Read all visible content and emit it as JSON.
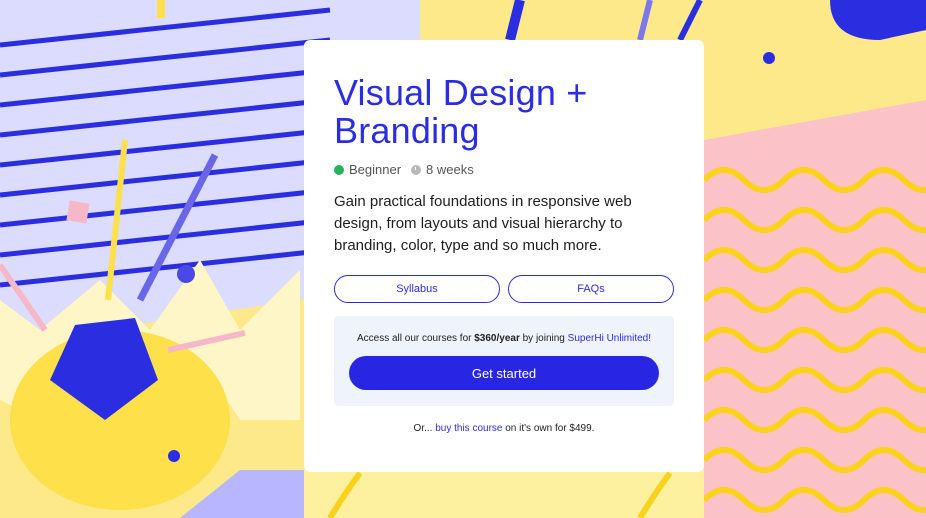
{
  "course": {
    "title_line1": "Visual Design +",
    "title_line2": "Branding",
    "level": "Beginner",
    "duration": "8 weeks",
    "description": "Gain practical foundations in responsive web design, from layouts and visual hierarchy to branding, color, type and so much more."
  },
  "buttons": {
    "syllabus": "Syllabus",
    "faqs": "FAQs",
    "cta": "Get started"
  },
  "access": {
    "prefix": "Access all our courses for ",
    "price": "$360/year",
    "middle": " by joining ",
    "link": "SuperHi Unlimited!"
  },
  "footer": {
    "prefix": "Or... ",
    "link": "buy this course",
    "middle": " on it's own for ",
    "price": "$499."
  },
  "colors": {
    "accent": "#2a2ee0",
    "cta": "#2826e3",
    "beginner_dot": "#25b35a",
    "access_bg": "#eef3fc"
  }
}
